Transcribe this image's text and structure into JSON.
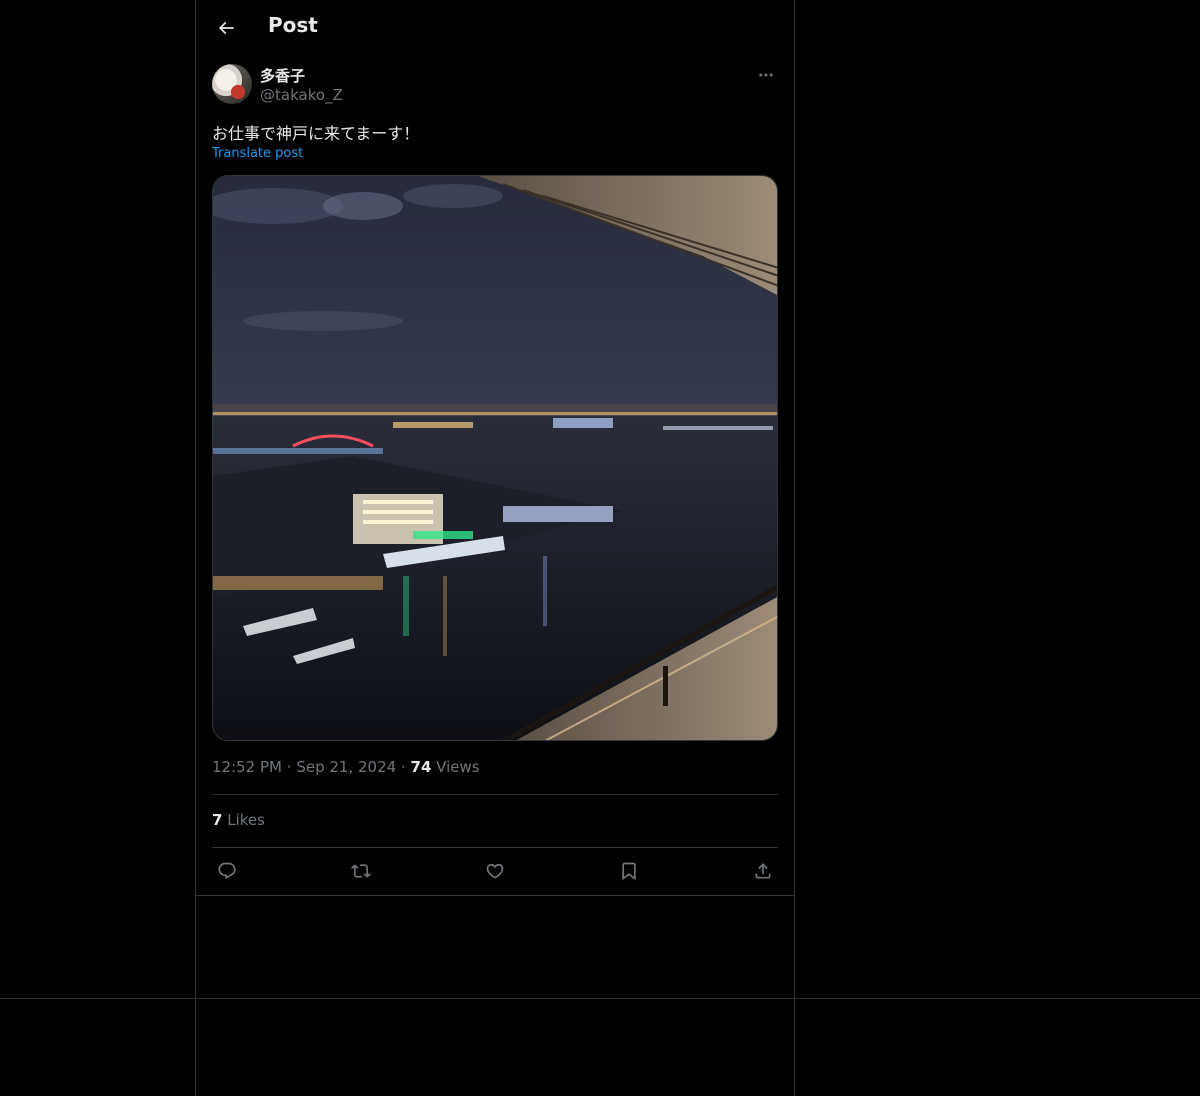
{
  "header": {
    "title": "Post",
    "back_icon": "arrow-left-icon"
  },
  "post": {
    "author": {
      "display_name": "多香子",
      "handle": "@takako_Z",
      "avatar_icon": "avatar-photo"
    },
    "more_icon": "more-horizontal-icon",
    "text": "お仕事で神戸に来てまーす！",
    "translate_label": "Translate post",
    "media": {
      "description_icon": "night-harbor-photo"
    },
    "time": "12:52 PM",
    "date": "Sep 21, 2024",
    "dot": "·",
    "views_count": "74",
    "views_label": "Views",
    "likes_count": "7",
    "likes_label": "Likes",
    "actions": [
      {
        "name": "reply",
        "icon": "reply-icon"
      },
      {
        "name": "repost",
        "icon": "repost-icon"
      },
      {
        "name": "like",
        "icon": "heart-icon"
      },
      {
        "name": "bookmark",
        "icon": "bookmark-icon"
      },
      {
        "name": "share",
        "icon": "share-icon"
      }
    ]
  },
  "colors": {
    "background": "#000000",
    "text": "#e7e9ea",
    "secondary": "#71767b",
    "accent": "#1d9bf0",
    "border": "#2f3336"
  }
}
